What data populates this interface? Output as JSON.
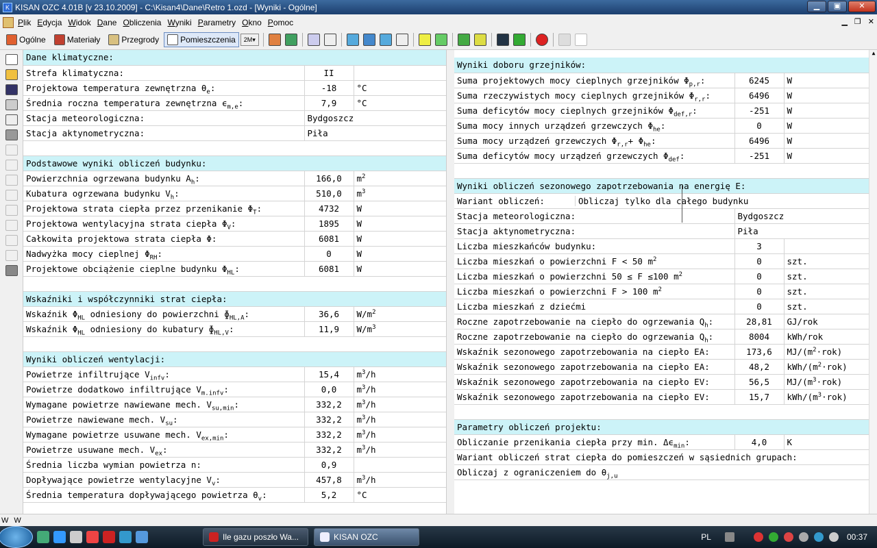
{
  "window": {
    "title": "KISAN OZC 4.01B [v 23.10.2009] - C:\\Kisan4\\Dane\\Retro 1.ozd - [Wyniki - Ogólne]"
  },
  "menu": [
    "Plik",
    "Edycja",
    "Widok",
    "Dane",
    "Obliczenia",
    "Wyniki",
    "Parametry",
    "Okno",
    "Pomoc"
  ],
  "toolbar": {
    "ogolne": "Ogólne",
    "materialy": "Materiały",
    "przegrody": "Przegrody",
    "pomieszczenia": "Pomieszczenia",
    "unit": "2M"
  },
  "left": {
    "klim_header": "Dane klimatyczne:",
    "klim": [
      {
        "label": "Strefa klimatyczna:",
        "value": "II",
        "unit": ""
      },
      {
        "label": "Projektowa temperatura zewnętrzna θ",
        "sub": "e",
        "tail": ":",
        "value": "-18",
        "unit": "°C"
      },
      {
        "label": "Średnia roczna temperatura zewnętrzna ϵ",
        "sub": "m,e",
        "tail": ":",
        "value": "7,9",
        "unit": "°C"
      },
      {
        "label": "Stacja meteorologiczna:",
        "value": "Bydgoszcz",
        "unit": "",
        "wide": true
      },
      {
        "label": "Stacja aktynometryczna:",
        "value": "Piła",
        "unit": "",
        "wide": true
      }
    ],
    "bud_header": "Podstawowe wyniki obliczeń budynku:",
    "bud": [
      {
        "label": "Powierzchnia ogrzewana budynku A",
        "sub": "h",
        "tail": ":",
        "value": "166,0",
        "unit": "m",
        "usup": "2"
      },
      {
        "label": "Kubatura ogrzewana budynku V",
        "sub": "h",
        "tail": ":",
        "value": "510,0",
        "unit": "m",
        "usup": "3"
      },
      {
        "label": "Projektowa strata ciepła przez przenikanie Φ",
        "sub": "T",
        "tail": ":",
        "value": "4732",
        "unit": "W"
      },
      {
        "label": "Projektowa wentylacyjna strata ciepła Φ",
        "sub": "V",
        "tail": ":",
        "value": "1895",
        "unit": "W"
      },
      {
        "label": "Całkowita projektowa strata ciepła Φ:",
        "value": "6081",
        "unit": "W"
      },
      {
        "label": "Nadwyżka mocy cieplnej Φ",
        "sub": "RH",
        "tail": ":",
        "value": "0",
        "unit": "W"
      },
      {
        "label": "Projektowe obciążenie cieplne budynku Φ",
        "sub": "HL",
        "tail": ":",
        "value": "6081",
        "unit": "W"
      }
    ],
    "wsk_header": "Wskaźniki i współczynniki strat ciepła:",
    "wsk": [
      {
        "label": "Wskaźnik Φ",
        "sub": "HL",
        "tail": " odniesiony do powierzchni ɸ",
        "sub2": "HL,A",
        "tail2": ":",
        "value": "36,6",
        "unit": "W/m",
        "usup": "2"
      },
      {
        "label": "Wskaźnik Φ",
        "sub": "HL",
        "tail": " odniesiony do kubatury ɸ",
        "sub2": "HL,V",
        "tail2": ":",
        "value": "11,9",
        "unit": "W/m",
        "usup": "3"
      }
    ],
    "went_header": "Wyniki obliczeń wentylacji:",
    "went": [
      {
        "label": "Powietrze infiltrujące V",
        "sub": "infv",
        "tail": ":",
        "value": "15,4",
        "unit": "m",
        "usup": "3",
        "utail": "/h"
      },
      {
        "label": "Powietrze dodatkowo infiltrujące V",
        "sub": "m.infv",
        "tail": ":",
        "value": "0,0",
        "unit": "m",
        "usup": "3",
        "utail": "/h"
      },
      {
        "label": "Wymagane powietrze nawiewane mech. V",
        "sub": "su,min",
        "tail": ":",
        "value": "332,2",
        "unit": "m",
        "usup": "3",
        "utail": "/h"
      },
      {
        "label": "Powietrze nawiewane mech. V",
        "sub": "su",
        "tail": ":",
        "value": "332,2",
        "unit": "m",
        "usup": "3",
        "utail": "/h"
      },
      {
        "label": "Wymagane powietrze usuwane mech. V",
        "sub": "ex,min",
        "tail": ":",
        "value": "332,2",
        "unit": "m",
        "usup": "3",
        "utail": "/h"
      },
      {
        "label": "Powietrze usuwane mech. V",
        "sub": "ex",
        "tail": ":",
        "value": "332,2",
        "unit": "m",
        "usup": "3",
        "utail": "/h"
      },
      {
        "label": "Średnia liczba wymian powietrza n:",
        "value": "0,9",
        "unit": ""
      },
      {
        "label": "Dopływające powietrze wentylacyjne V",
        "sub": "v",
        "tail": ":",
        "value": "457,8",
        "unit": "m",
        "usup": "3",
        "utail": "/h"
      },
      {
        "label": "Średnia temperatura dopływającego powietrza θ",
        "sub": "v",
        "tail": ":",
        "value": "5,2",
        "unit": "°C"
      }
    ]
  },
  "right": {
    "grz_header": "Wyniki doboru grzejników:",
    "grz": [
      {
        "label": "Suma projektowych mocy cieplnych grzejników Φ",
        "sub": "p,r",
        "tail": ":",
        "value": "6245",
        "unit": "W"
      },
      {
        "label": "Suma rzeczywistych mocy cieplnych grzejników Φ",
        "sub": "r,r",
        "tail": ":",
        "value": "6496",
        "unit": "W"
      },
      {
        "label": "Suma deficytów mocy cieplnych grzejników Φ",
        "sub": "def,r",
        "tail": ":",
        "value": "-251",
        "unit": "W"
      },
      {
        "label": "Suma mocy innych urządzeń grzewczych Φ",
        "sub": "he",
        "tail": ":",
        "value": "0",
        "unit": "W"
      },
      {
        "label": "Suma mocy urządzeń grzewczych Φ",
        "sub": "r,r",
        "tail": "+ Φ",
        "sub2": "he",
        "tail2": ":",
        "value": "6496",
        "unit": "W"
      },
      {
        "label": "Suma deficytów mocy urządzeń grzewczych Φ",
        "sub": "def",
        "tail": ":",
        "value": "-251",
        "unit": "W"
      }
    ],
    "sez_header": "Wyniki obliczeń sezonowego zapotrzebowania na energię E:",
    "wariant_label": "Wariant obliczeń:",
    "wariant_value": "Obliczaj tylko dla całego budynku",
    "sez": [
      {
        "label": "Stacja meteorologiczna:",
        "value": "Bydgoszcz",
        "unit": "",
        "wide": true
      },
      {
        "label": "Stacja aktynometryczna:",
        "value": "Piła",
        "unit": "",
        "wide": true
      },
      {
        "label": "Liczba mieszkańców budynku:",
        "value": "3",
        "unit": ""
      },
      {
        "label": "Liczba mieszkań o powierzchni F < 50 m",
        "lsup": "2",
        "value": "0",
        "unit": "szt."
      },
      {
        "label": "Liczba mieszkań o powierzchni 50 ≤ F ≤100 m",
        "lsup": "2",
        "value": "0",
        "unit": "szt."
      },
      {
        "label": "Liczba mieszkań o powierzchni F > 100 m",
        "lsup": "2",
        "value": "0",
        "unit": "szt."
      },
      {
        "label": "Liczba mieszkań z dziećmi",
        "value": "0",
        "unit": "szt."
      },
      {
        "label": "Roczne zapotrzebowanie na ciepło do ogrzewania Q",
        "sub": "h",
        "tail": ":",
        "value": "28,81",
        "unit": "GJ/rok"
      },
      {
        "label": "Roczne zapotrzebowanie na ciepło do ogrzewania Q",
        "sub": "h",
        "tail": ":",
        "value": "8004",
        "unit": "kWh/rok"
      },
      {
        "label": "Wskaźnik sezonowego zapotrzebowania na ciepło EA:",
        "value": "173,6",
        "unit": "MJ/(m",
        "usup": "2",
        "utail": "·rok)"
      },
      {
        "label": "Wskaźnik sezonowego zapotrzebowania na ciepło EA:",
        "value": "48,2",
        "unit": "kWh/(m",
        "usup": "2",
        "utail": "·rok)"
      },
      {
        "label": "Wskaźnik sezonowego zapotrzebowania na ciepło EV:",
        "value": "56,5",
        "unit": "MJ/(m",
        "usup": "3",
        "utail": "·rok)"
      },
      {
        "label": "Wskaźnik sezonowego zapotrzebowania na ciepło EV:",
        "value": "15,7",
        "unit": "kWh/(m",
        "usup": "3",
        "utail": "·rok)"
      }
    ],
    "par_header": "Parametry obliczeń projektu:",
    "par": [
      {
        "label": "Obliczanie przenikania ciepła przy min. Δϵ",
        "sub": "min",
        "tail": ":",
        "value": "4,0",
        "unit": "K"
      }
    ],
    "par_text1": "Wariant obliczeń strat ciepła do pomieszczeń w sąsiednich grupach:",
    "par_text2": "Obliczaj z ograniczeniem do θ",
    "par_text2_sub": "j,u"
  },
  "statusbar": [
    "W",
    "W"
  ],
  "taskbar": {
    "tasks": [
      "Ile gazu poszło Wa...",
      "KISAN OZC"
    ],
    "lang": "PL",
    "clock": "00:37"
  }
}
